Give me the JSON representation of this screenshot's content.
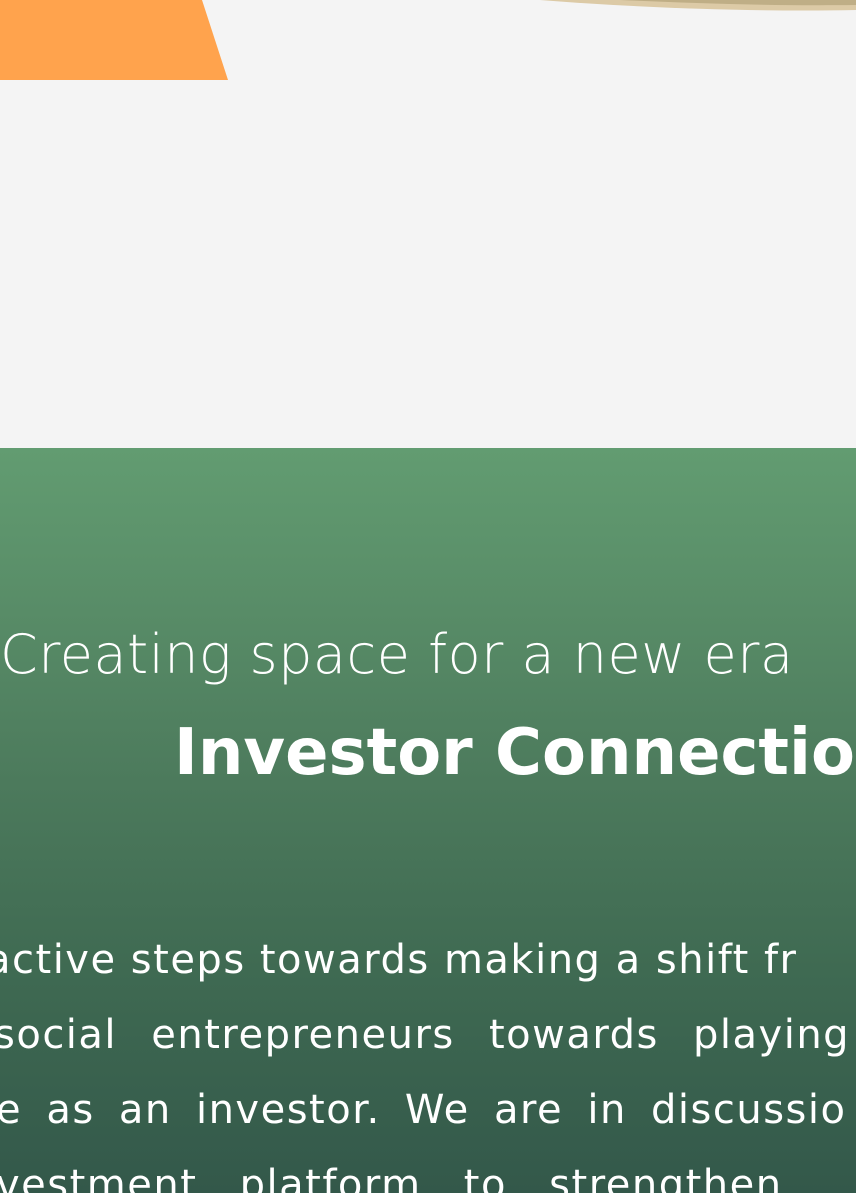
{
  "hero": {
    "image_accent": "#ffa34d",
    "image_background": "#f4f4f4"
  },
  "section": {
    "subtitle": "Creating space for a new era",
    "title": "Investor Connection",
    "body_lines": [
      "active steps towards making a shift fr",
      "social entrepreneurs towards playing",
      "e as an investor. We are in discussio",
      "vestment platform to strengthen"
    ],
    "colors": {
      "gradient_top": "#629c71",
      "gradient_bottom": "#33584a",
      "text": "#ffffff"
    }
  }
}
